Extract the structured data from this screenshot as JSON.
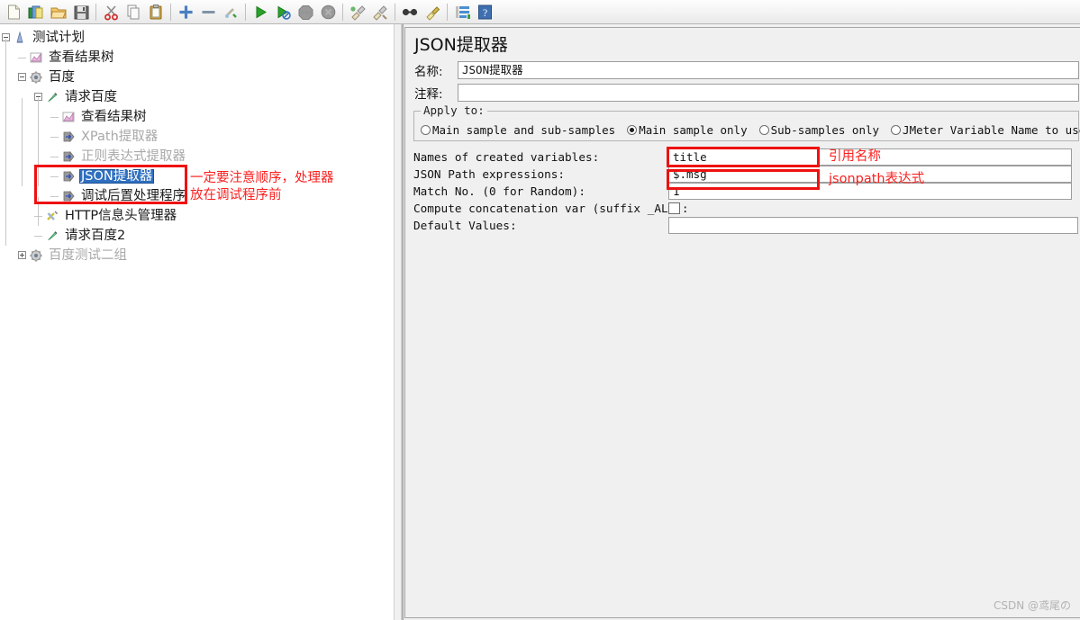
{
  "toolbar": {
    "buttons": [
      {
        "name": "new-icon",
        "label": "New"
      },
      {
        "name": "templates-icon",
        "label": "Templates"
      },
      {
        "name": "open-icon",
        "label": "Open"
      },
      {
        "name": "save-icon",
        "label": "Save"
      },
      {
        "name": "cut-icon",
        "label": "Cut"
      },
      {
        "name": "copy-icon",
        "label": "Copy"
      },
      {
        "name": "paste-icon",
        "label": "Paste"
      },
      {
        "name": "expand-all-icon",
        "label": "Expand All"
      },
      {
        "name": "collapse-all-icon",
        "label": "Collapse All"
      },
      {
        "name": "toggle-icon",
        "label": "Toggle"
      },
      {
        "name": "start-icon",
        "label": "Start"
      },
      {
        "name": "start-no-timers-icon",
        "label": "Start no pauses"
      },
      {
        "name": "stop-icon",
        "label": "Stop"
      },
      {
        "name": "shutdown-icon",
        "label": "Shutdown"
      },
      {
        "name": "clear-icon",
        "label": "Clear"
      },
      {
        "name": "clear-all-icon",
        "label": "Clear All"
      },
      {
        "name": "search-icon",
        "label": "Search"
      },
      {
        "name": "reset-search-icon",
        "label": "Reset Search"
      },
      {
        "name": "function-helper-icon",
        "label": "Function Helper Dialog"
      },
      {
        "name": "help-icon",
        "label": "Help"
      }
    ]
  },
  "tree": {
    "nodes": [
      {
        "label": "测试计划",
        "icon": "test-plan-icon",
        "depth": 0,
        "handle": "minus",
        "selected": false,
        "disabled": false
      },
      {
        "label": "查看结果树",
        "icon": "view-results-tree-icon",
        "depth": 1,
        "handle": "none",
        "selected": false,
        "disabled": false
      },
      {
        "label": "百度",
        "icon": "thread-group-icon",
        "depth": 1,
        "handle": "minus",
        "selected": false,
        "disabled": false
      },
      {
        "label": "请求百度",
        "icon": "http-request-icon",
        "depth": 2,
        "handle": "minus",
        "selected": false,
        "disabled": false
      },
      {
        "label": "查看结果树",
        "icon": "view-results-tree-icon",
        "depth": 3,
        "handle": "none",
        "selected": false,
        "disabled": false
      },
      {
        "label": "XPath提取器",
        "icon": "post-processor-icon",
        "depth": 3,
        "handle": "none",
        "selected": false,
        "disabled": true
      },
      {
        "label": "正则表达式提取器",
        "icon": "post-processor-icon",
        "depth": 3,
        "handle": "none",
        "selected": false,
        "disabled": true
      },
      {
        "label": "JSON提取器",
        "icon": "post-processor-icon",
        "depth": 3,
        "handle": "none",
        "selected": true,
        "disabled": false
      },
      {
        "label": "调试后置处理程序",
        "icon": "post-processor-icon",
        "depth": 3,
        "handle": "none",
        "selected": false,
        "disabled": false
      },
      {
        "label": "HTTP信息头管理器",
        "icon": "header-manager-icon",
        "depth": 2,
        "handle": "none",
        "selected": false,
        "disabled": false
      },
      {
        "label": "请求百度2",
        "icon": "http-request-icon",
        "depth": 2,
        "handle": "none",
        "selected": false,
        "disabled": false
      },
      {
        "label": "百度测试二组",
        "icon": "thread-group-icon",
        "depth": 1,
        "handle": "plus",
        "selected": false,
        "disabled": true
      }
    ]
  },
  "annotations": {
    "order_note": "一定要注意顺序，处理器\n放在调试程序前",
    "ref_name_note": "引用名称",
    "jsonpath_note": "jsonpath表达式",
    "color": "#fb2020"
  },
  "editor": {
    "title": "JSON提取器",
    "name_label": "名称:",
    "name_value": "JSON提取器",
    "comment_label": "注释:",
    "comment_value": "",
    "apply_to": {
      "legend": "Apply to:",
      "options": [
        {
          "label": "Main sample and sub-samples",
          "selected": false
        },
        {
          "label": "Main sample only",
          "selected": true
        },
        {
          "label": "Sub-samples only",
          "selected": false
        },
        {
          "label": "JMeter Variable Name to use",
          "selected": false
        }
      ],
      "variable_value": ""
    },
    "fields": [
      {
        "label": "Names of created variables:",
        "value": "title",
        "type": "text"
      },
      {
        "label": "JSON Path expressions:",
        "value": "$.msg",
        "type": "text"
      },
      {
        "label": "Match No. (0 for Random):",
        "value": "1",
        "type": "text"
      },
      {
        "label": "Compute concatenation var (suffix _ALL):",
        "value": "",
        "type": "checkbox",
        "checked": false
      },
      {
        "label": "Default Values:",
        "value": "",
        "type": "text"
      }
    ]
  },
  "watermark": "CSDN @鸢尾の"
}
